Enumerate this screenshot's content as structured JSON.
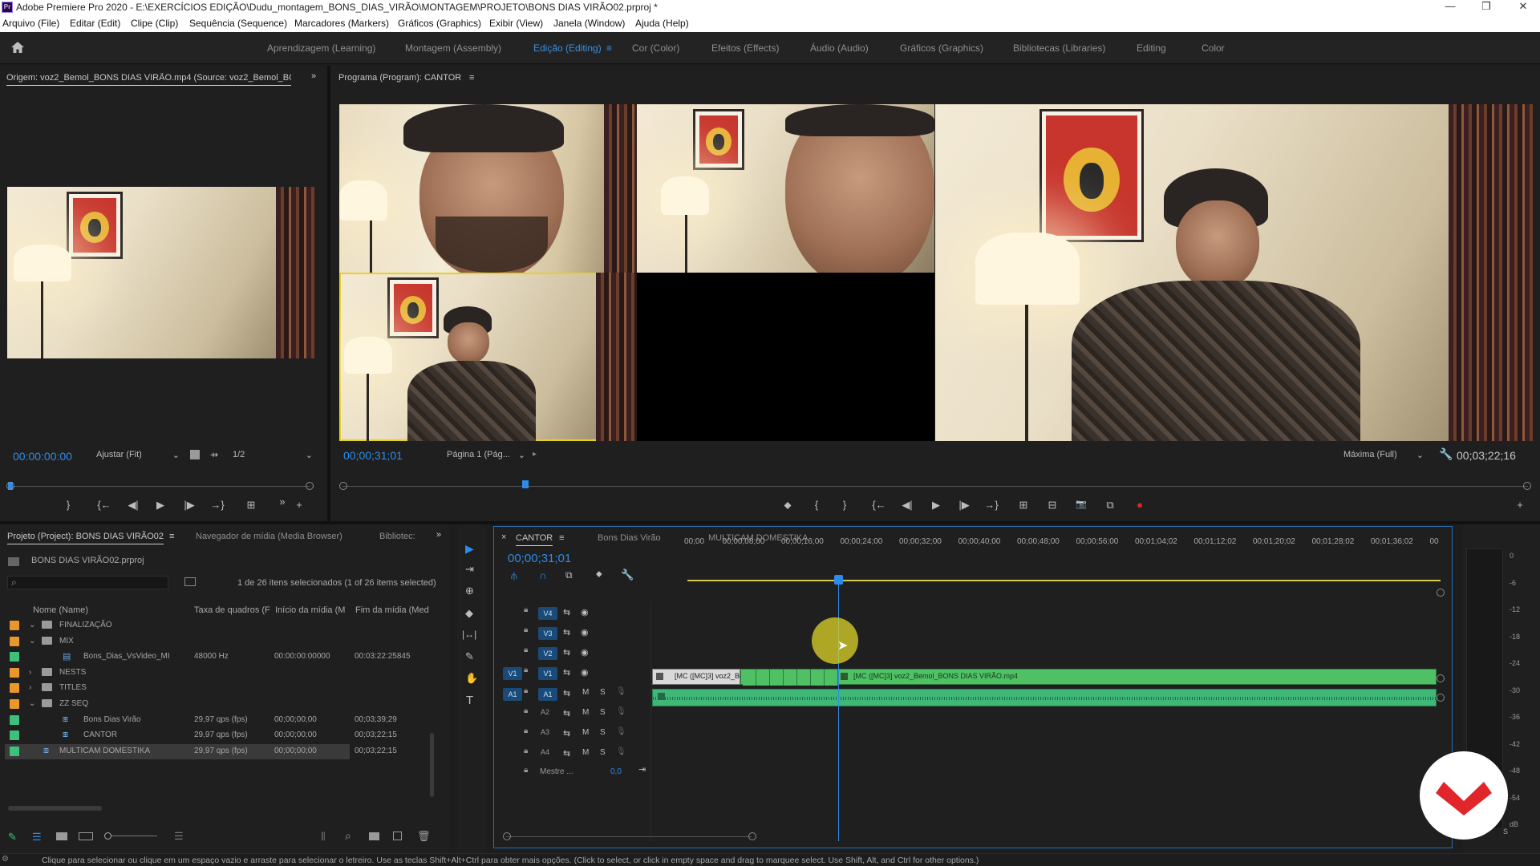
{
  "window": {
    "logo": "Pr",
    "title": "Adobe Premiere Pro 2020 - E:\\EXERCÍCIOS EDIÇÃO\\Dudu_montagem_BONS_DIAS_VIRÃO\\MONTAGEM\\PROJETO\\BONS DIAS VIRÃO02.prproj *",
    "minimize": "—",
    "restore": "❐",
    "close": "✕"
  },
  "menu": [
    "Arquivo (File)",
    "Editar (Edit)",
    "Clipe (Clip)",
    "Sequência (Sequence)",
    "Marcadores (Markers)",
    "Gráficos (Graphics)",
    "Exibir (View)",
    "Janela (Window)",
    "Ajuda (Help)"
  ],
  "workspaces": {
    "home_icon": "home-icon",
    "items": [
      "Aprendizagem (Learning)",
      "Montagem (Assembly)",
      "Edição (Editing)",
      "Cor (Color)",
      "Efeitos (Effects)",
      "Áudio (Audio)",
      "Gráficos (Graphics)",
      "Bibliotecas (Libraries)",
      "Editing",
      "Color"
    ],
    "active": "Edição (Editing)",
    "menu_glyph": "≡"
  },
  "source_monitor": {
    "tab": "Origem: voz2_Bemol_BONS DIAS VIRÃO.mp4 (Source: voz2_Bemol_BO",
    "expand": "»",
    "timecode": "00:00:00:00",
    "fit": "Ajustar (Fit)",
    "resolution": "1/2",
    "controls": [
      "}",
      "{←",
      "◀|",
      "▶",
      "|▶",
      "→}",
      "⊞",
      "»",
      "+"
    ]
  },
  "program_monitor": {
    "tab": "Programa (Program): CANTOR",
    "menu": "≡",
    "timecode": "00;00;31;01",
    "page": "Página 1 (Pág...",
    "quality": "Máxima (Full)",
    "duration": "00;03;22;16",
    "controls": [
      "⬥",
      "{",
      "}",
      "{←",
      "◀|",
      "▶",
      "|▶",
      "→}",
      "⊞",
      "⊟",
      "📷",
      "⧉",
      "●",
      "+"
    ],
    "playhead_fraction": 0.154
  },
  "project_panel": {
    "tab": "Projeto (Project): BONS DIAS VIRÃO02",
    "tab_menu": "≡",
    "tabs": [
      "Navegador de mídia (Media Browser)",
      "Bibliotec:"
    ],
    "expand": "»",
    "file": "BONS DIAS VIRÃO02.prproj",
    "search_icon": "⌕",
    "selection_info": "1 de 26 itens selecionados (1 of 26 items selected)",
    "columns": [
      "Nome (Name)",
      "Taxa de quadros (F",
      "Início da mídia (M",
      "Fim da mídia (Med"
    ],
    "rows": [
      {
        "color": "#e9962c",
        "indent": 0,
        "expand": "⌄",
        "type": "folder",
        "name": "FINALIZAÇÃO",
        "rate": "",
        "start": "",
        "end": ""
      },
      {
        "color": "#e9962c",
        "indent": 0,
        "expand": "⌄",
        "type": "folder",
        "name": "MIX",
        "rate": "",
        "start": "",
        "end": ""
      },
      {
        "color": "#3ec07a",
        "indent": 1,
        "expand": "",
        "type": "clip",
        "name": "Bons_Dias_VsVideo_MI",
        "rate": "48000 Hz",
        "start": "00:00:00:00000",
        "end": "00:03:22:25845"
      },
      {
        "color": "#e9962c",
        "indent": 0,
        "expand": "›",
        "type": "folder",
        "name": "NESTS",
        "rate": "",
        "start": "",
        "end": ""
      },
      {
        "color": "#e9962c",
        "indent": 0,
        "expand": "›",
        "type": "folder",
        "name": "TITLES",
        "rate": "",
        "start": "",
        "end": ""
      },
      {
        "color": "#e9962c",
        "indent": 0,
        "expand": "⌄",
        "type": "folder",
        "name": "ZZ SEQ",
        "rate": "",
        "start": "",
        "end": ""
      },
      {
        "color": "#3ec07a",
        "indent": 1,
        "expand": "",
        "type": "seq",
        "name": "Bons Dias Virão",
        "rate": "29,97 qps (fps)",
        "start": "00;00;00;00",
        "end": "00;03;39;29"
      },
      {
        "color": "#3ec07a",
        "indent": 1,
        "expand": "",
        "type": "seq",
        "name": "CANTOR",
        "rate": "29,97 qps (fps)",
        "start": "00;00;00;00",
        "end": "00;03;22;15"
      },
      {
        "color": "#3ec07a",
        "indent": 0,
        "expand": "",
        "type": "seq",
        "name": "MULTICAM DOMESTIKA",
        "rate": "29,97 qps (fps)",
        "start": "00;00;00;00",
        "end": "00;03;22;15"
      }
    ],
    "selected_row": 8
  },
  "tools": [
    "▶",
    "⇥",
    "⊕",
    "◆",
    "|↔|",
    "✎",
    "✋",
    "T"
  ],
  "timeline": {
    "close": "×",
    "tabs": [
      "CANTOR",
      "Bons Dias Virão",
      "MULTICAM DOMESTIKA"
    ],
    "active_tab": "CANTOR",
    "tab_menu": "≡",
    "timecode": "00;00;31;01",
    "ruler": [
      "00;00",
      "00;00;08;00",
      "00;00;16;00",
      "00;00;24;00",
      "00;00;32;00",
      "00;00;40;00",
      "00;00;48;00",
      "00;00;56;00",
      "00;01;04;02",
      "00;01;12;02",
      "00;01;20;02",
      "00;01;28;02",
      "00;01;36;02",
      "00"
    ],
    "video_tracks": [
      "V4",
      "V3",
      "V2",
      "V1"
    ],
    "audio_tracks": [
      "A1",
      "A2",
      "A3",
      "A4"
    ],
    "source_patch_v": "V1",
    "source_patch_a": "A1",
    "mute": "M",
    "solo": "S",
    "master_label": "Mestre ...",
    "master_value": "0,0",
    "clip1_label": "[MC ([MC]3] voz2_Be",
    "clip2_label": "[MC ([MC]3] voz2_Bemol_BONS DIAS VIRÃO.mp4"
  },
  "audio_meter": {
    "scale": [
      "0",
      "-6",
      "-12",
      "-18",
      "-24",
      "-30",
      "-36",
      "-42",
      "-48",
      "-54",
      "dB"
    ],
    "solo": "S"
  },
  "status_bar": "Clique para selecionar ou clique em um espaço vazio e arraste para selecionar o letreiro. Use as teclas Shift+Alt+Ctrl para obter mais opções. (Click to select, or click in empty space and drag to marquee select. Use Shift, Alt, and Ctrl for other options.)"
}
